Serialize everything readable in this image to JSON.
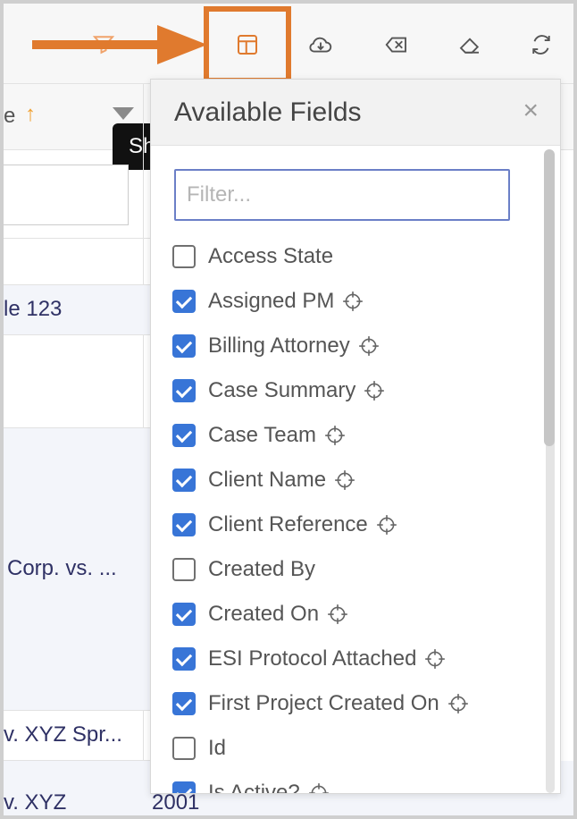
{
  "toolbar": {
    "icons": [
      "filter-icon",
      "columns-layout-icon",
      "cloud-download-icon",
      "clear-icon",
      "eraser-icon",
      "refresh-icon"
    ],
    "highlight_color": "#e07a2e",
    "icon_color": "#555555"
  },
  "grid": {
    "header_partial": "e",
    "sort_icon": "↑",
    "tooltip_partial": "Sh",
    "cells": [
      {
        "text": "le 123"
      },
      {
        "text": "Corp. vs. ..."
      },
      {
        "text": "v. XYZ Spr..."
      },
      {
        "text": "v. XYZ"
      },
      {
        "text": "2001"
      }
    ]
  },
  "panel": {
    "title": "Available Fields",
    "close_label": "×",
    "filter_placeholder": "Filter...",
    "fields": [
      {
        "label": "Access State",
        "checked": false,
        "target": false
      },
      {
        "label": "Assigned PM",
        "checked": true,
        "target": true
      },
      {
        "label": "Billing Attorney",
        "checked": true,
        "target": true
      },
      {
        "label": "Case Summary",
        "checked": true,
        "target": true
      },
      {
        "label": "Case Team",
        "checked": true,
        "target": true
      },
      {
        "label": "Client Name",
        "checked": true,
        "target": true
      },
      {
        "label": "Client Reference",
        "checked": true,
        "target": true
      },
      {
        "label": "Created By",
        "checked": false,
        "target": false
      },
      {
        "label": "Created On",
        "checked": true,
        "target": true
      },
      {
        "label": "ESI Protocol Attached",
        "checked": true,
        "target": true
      },
      {
        "label": "First Project Created On",
        "checked": true,
        "target": true
      },
      {
        "label": "Id",
        "checked": false,
        "target": false
      },
      {
        "label": "Is Active?",
        "checked": true,
        "target": true
      }
    ],
    "accent": "#3875d7"
  }
}
